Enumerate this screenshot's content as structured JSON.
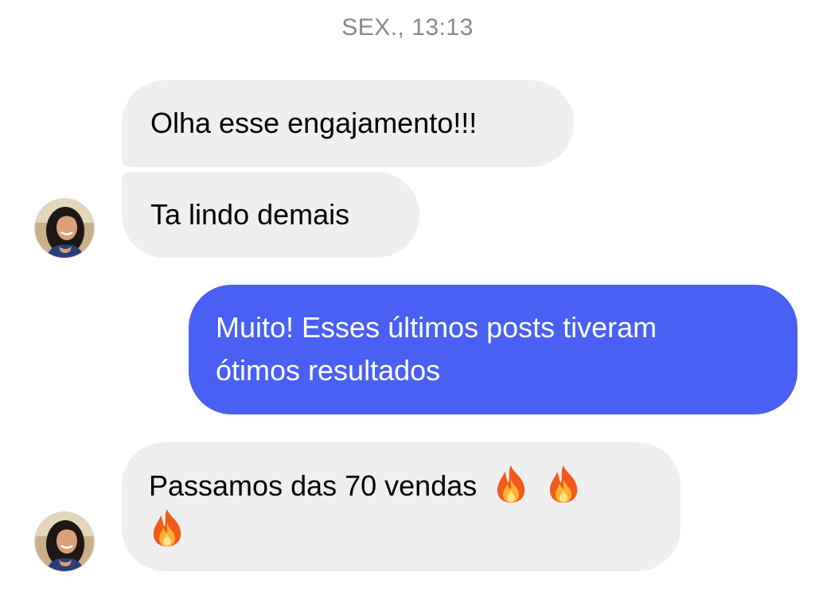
{
  "conversation": {
    "timestamp": "SEX., 13:13",
    "messages": [
      {
        "direction": "incoming",
        "text": "Olha esse engajamento!!!"
      },
      {
        "direction": "incoming",
        "text": "Ta lindo demais"
      },
      {
        "direction": "outgoing",
        "lines": [
          "Muito! Esses últimos posts tiveram",
          "ótimos resultados"
        ]
      },
      {
        "direction": "incoming",
        "text": "Passamos das 70 vendas",
        "emoji": [
          "fire-icon",
          "fire-icon",
          "fire-icon"
        ]
      }
    ]
  },
  "colors": {
    "incoming_bubble": "#efefef",
    "outgoing_bubble": "#4a5ff3",
    "timestamp_text": "#8a8a8e"
  }
}
